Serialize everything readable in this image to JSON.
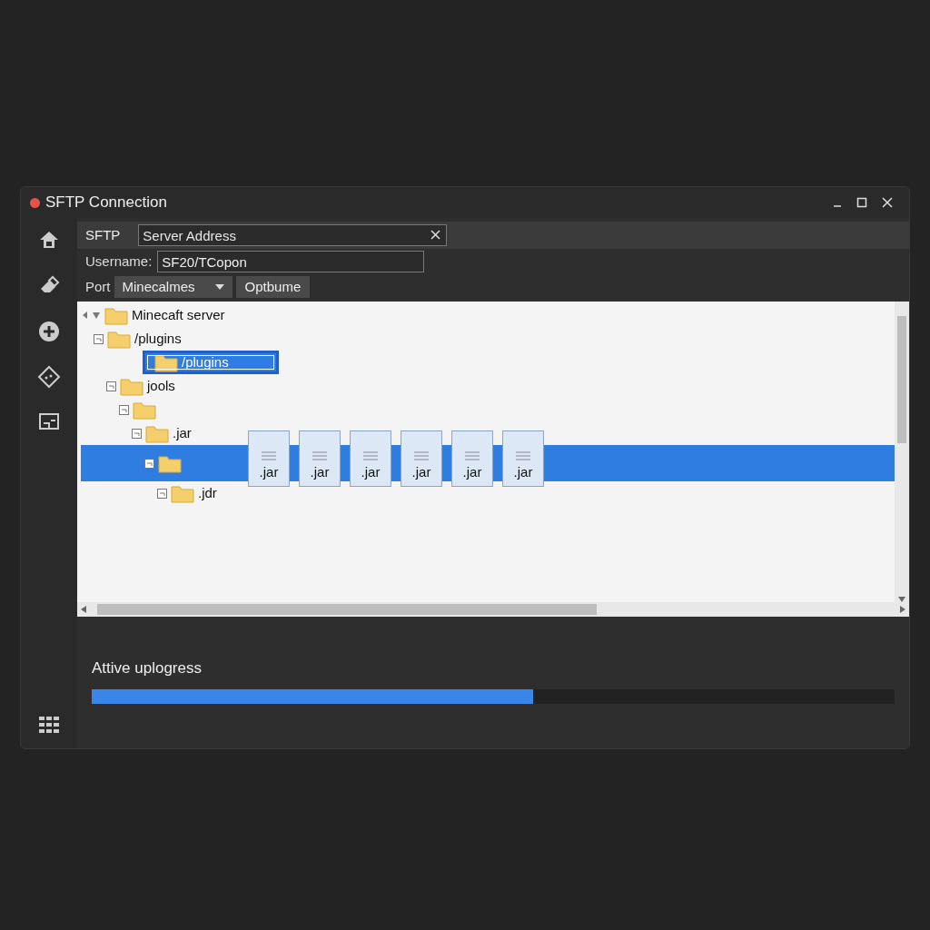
{
  "window": {
    "title": "SFTP Connection"
  },
  "sidebar": {
    "items": [
      {
        "kind": "home"
      },
      {
        "kind": "eraser"
      },
      {
        "kind": "add"
      },
      {
        "kind": "diamond"
      },
      {
        "kind": "monitor"
      }
    ],
    "bottom": {
      "kind": "grid"
    }
  },
  "connection": {
    "protocol": "SFTP",
    "server": {
      "placeholder": "Server Address"
    },
    "username_label": "Username:",
    "username": "SF20/TCopon",
    "port_label": "Port",
    "port_value": "Minecalmes",
    "option_button": "Optbume"
  },
  "tree": [
    {
      "label": "Minecaft server",
      "expanded": true,
      "selected": false,
      "children": [
        {
          "label": "/plugins",
          "selected": false,
          "children": [
            {
              "label": "/plugins",
              "selected": true
            },
            {
              "label": "jools",
              "selected": false,
              "children": [
                {
                  "selected": false,
                  "children": [
                    {
                      "label": ".jar",
                      "selected": false,
                      "children": [
                        {
                          "selected": true,
                          "files": [
                            ".jar",
                            ".jar",
                            ".jar",
                            ".jar",
                            ".jar",
                            ".jar"
                          ],
                          "children": [
                            {
                              "label": ".jdr",
                              "selected": false
                            }
                          ]
                        }
                      ]
                    }
                  ]
                }
              ]
            }
          ]
        }
      ]
    }
  ],
  "progress": {
    "label": "Attive uplogress",
    "level": 0.55
  }
}
